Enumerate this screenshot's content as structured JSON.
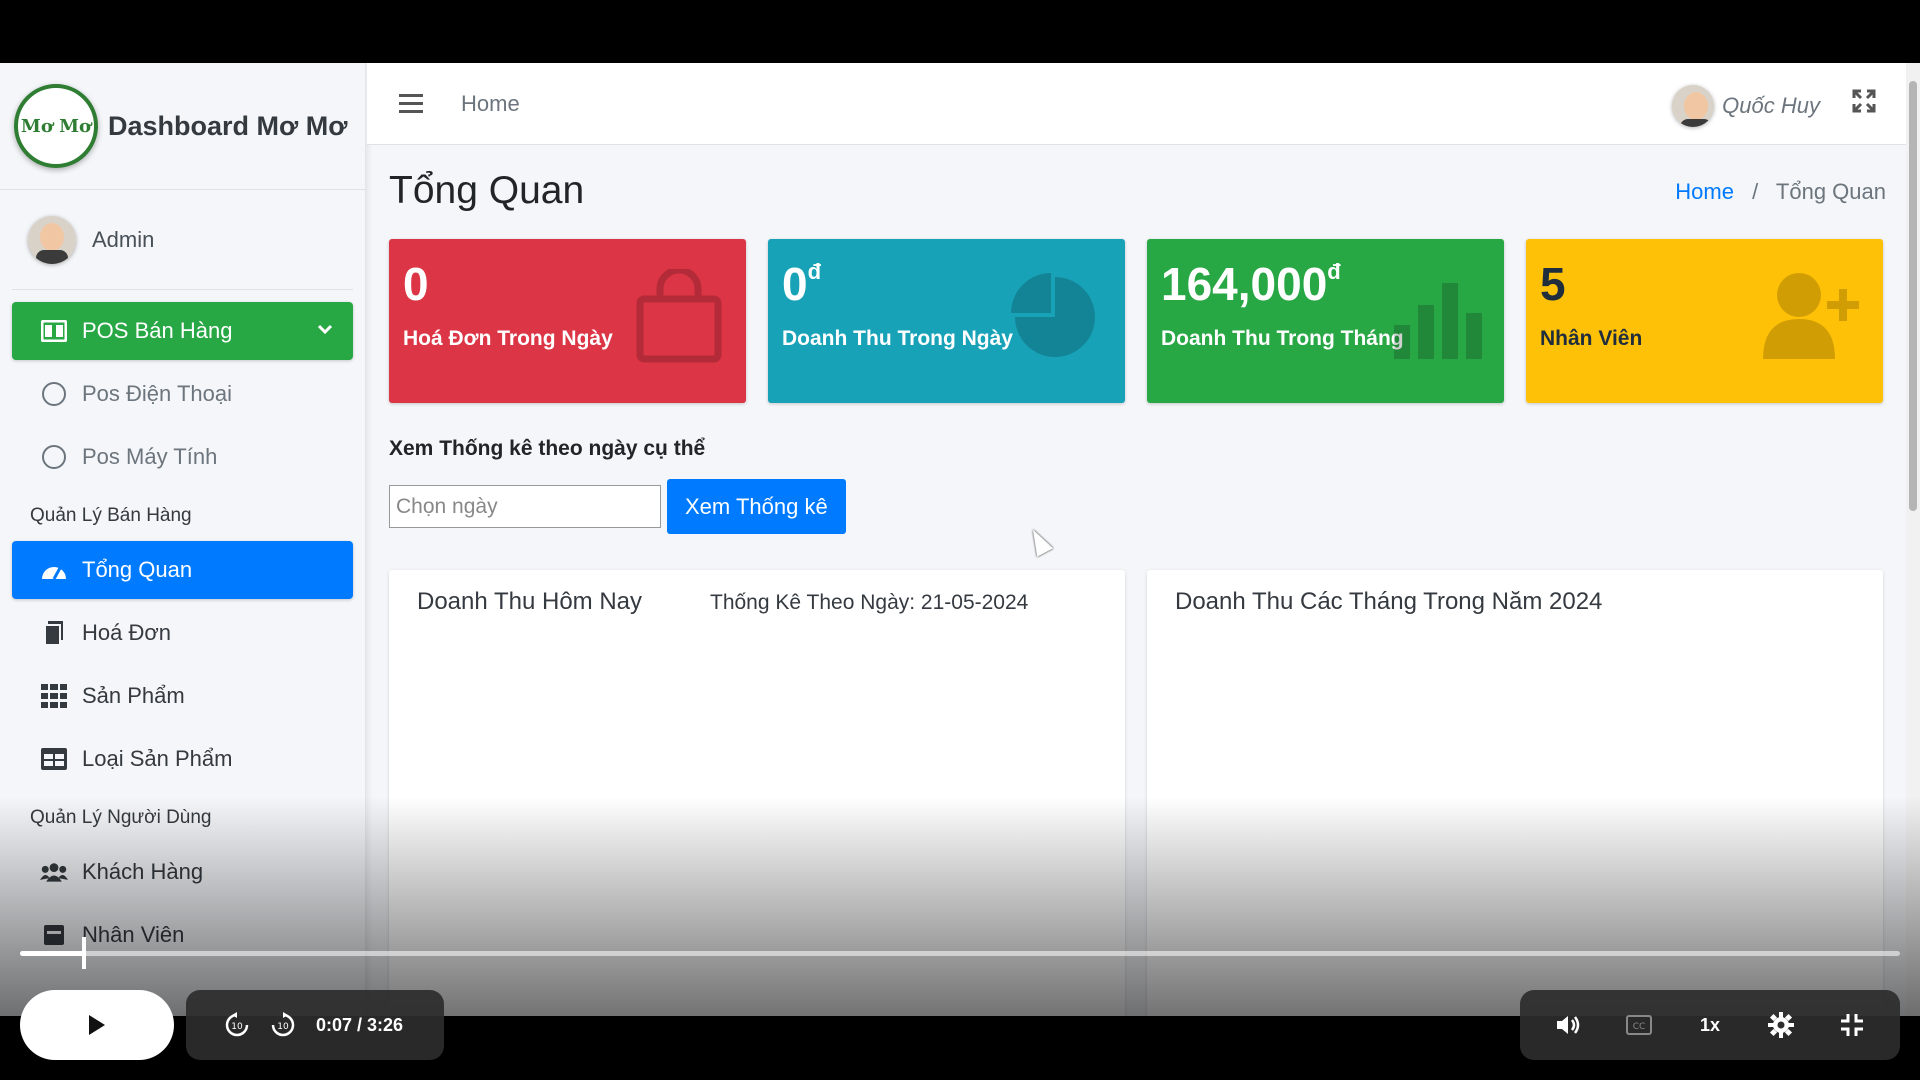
{
  "sidebar": {
    "brand_title": "Dashboard Mơ Mơ",
    "brand_logo_text": "Mơ Mơ",
    "user_name": "Admin",
    "pos_group": "POS Bán Hàng",
    "pos_items": [
      "Pos Điện Thoại",
      "Pos Máy Tính"
    ],
    "section_sales": "Quản Lý Bán Hàng",
    "sales_items": [
      {
        "label": "Tổng Quan",
        "icon": "gauge-icon"
      },
      {
        "label": "Hoá Đơn",
        "icon": "file-icon"
      },
      {
        "label": "Sản Phẩm",
        "icon": "grid-icon"
      },
      {
        "label": "Loại Sản Phẩm",
        "icon": "table-icon"
      }
    ],
    "section_users": "Quản Lý Người Dùng",
    "user_items": [
      {
        "label": "Khách Hàng",
        "icon": "users-icon"
      },
      {
        "label": "Nhân Viên",
        "icon": "id-card-icon"
      }
    ]
  },
  "topbar": {
    "home_link": "Home",
    "user_name": "Quốc Huy"
  },
  "page": {
    "title": "Tổng Quan",
    "breadcrumb_home": "Home",
    "breadcrumb_sep": "/",
    "breadcrumb_current": "Tổng Quan"
  },
  "stats": [
    {
      "value": "0",
      "unit": "",
      "label": "Hoá Đơn Trong Ngày",
      "color": "#dc3545",
      "icon": "shopping-bag-icon"
    },
    {
      "value": "0",
      "unit": "đ",
      "label": "Doanh Thu Trong Ngày",
      "color": "#17a2b8",
      "icon": "pie-chart-icon"
    },
    {
      "value": "164,000",
      "unit": "đ",
      "label": "Doanh Thu Trong Tháng",
      "color": "#28a745",
      "icon": "bar-chart-icon"
    },
    {
      "value": "5",
      "unit": "",
      "label": "Nhân Viên",
      "color": "#ffc107",
      "icon": "user-plus-icon"
    }
  ],
  "filter": {
    "title": "Xem Thống kê theo ngày cụ thể",
    "placeholder": "Chọn ngày",
    "button": "Xem Thống kê"
  },
  "cards": {
    "today_title": "Doanh Thu Hôm Nay",
    "today_sub": "Thống Kê Theo Ngày: 21-05-2024",
    "months_title": "Doanh Thu Các Tháng Trong Năm 2024"
  },
  "video": {
    "time": "0:07 / 3:26",
    "speed": "1x",
    "progress": 0.034
  }
}
